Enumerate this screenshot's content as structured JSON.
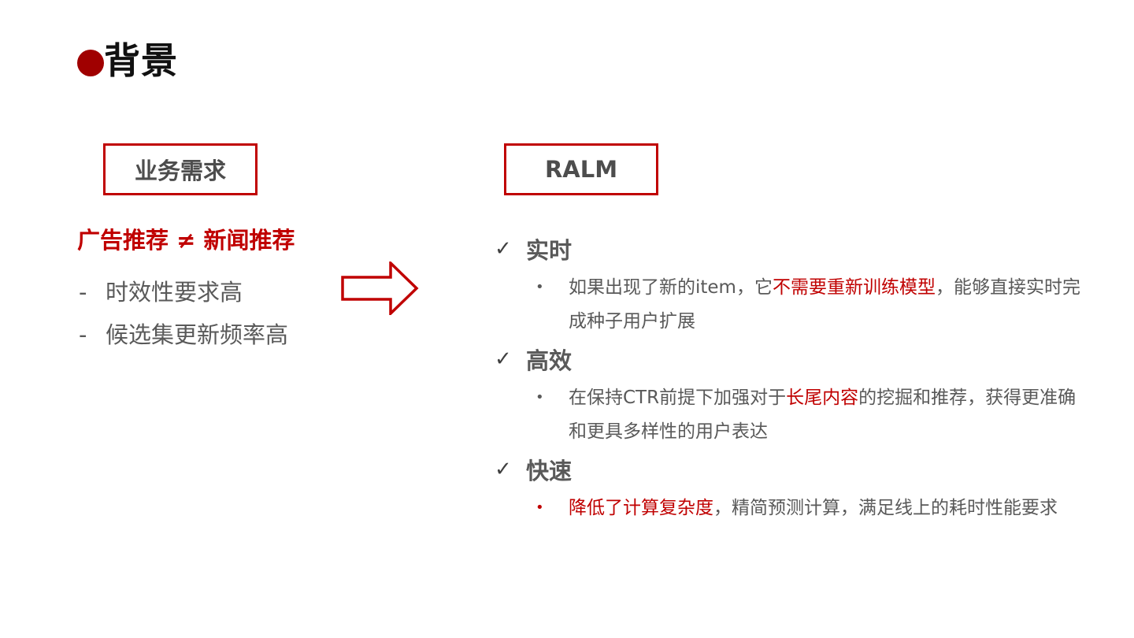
{
  "title": "背景",
  "colors": {
    "accent": "#c00000",
    "dot": "#a00000",
    "text": "#595959"
  },
  "left": {
    "box_label": "业务需求",
    "headline": "广告推荐 ≠ 新闻推荐",
    "items": [
      {
        "dash": "-",
        "text": "时效性要求高"
      },
      {
        "dash": "-",
        "text": "候选集更新频率高"
      }
    ]
  },
  "arrow_icon": "right-arrow-outline",
  "right": {
    "box_label": "RALM",
    "check_glyph": "✓",
    "bullet_glyph": "•",
    "features": [
      {
        "title": "实时",
        "body": {
          "before": "如果出现了新的item，它",
          "highlight": "不需要重新训练模型",
          "after": "，能够直接实时完成种子用户扩展"
        }
      },
      {
        "title": "高效",
        "body": {
          "before": "在保持CTR前提下加强对于",
          "highlight": "长尾内容",
          "after": "的挖掘和推荐，获得更准确和更具多样性的用户表达"
        }
      },
      {
        "title": "快速",
        "body": {
          "before": "",
          "highlight": "降低了计算复杂度",
          "after": "，精简预测计算，满足线上的耗时性能要求"
        }
      }
    ]
  }
}
